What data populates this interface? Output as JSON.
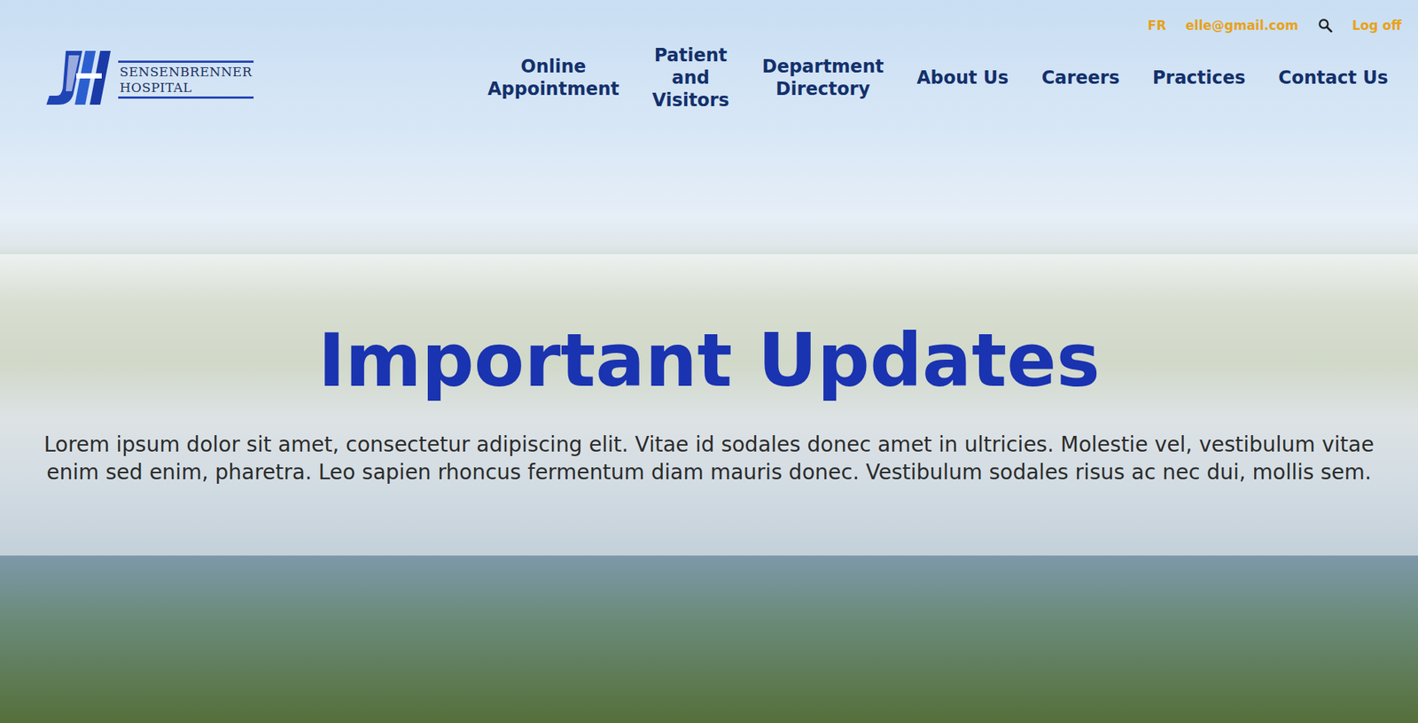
{
  "header": {
    "logo": {
      "line1": "SENSENBRENNER",
      "line2": "HOSPITAL"
    },
    "utility": {
      "language": "FR",
      "account": "elle@gmail.com",
      "logout": "Log off"
    },
    "nav": [
      {
        "label": "Online Appointment"
      },
      {
        "label": "Patient and Visitors"
      },
      {
        "label": "Department Directory"
      },
      {
        "label": "About Us"
      },
      {
        "label": "Careers"
      },
      {
        "label": "Practices"
      },
      {
        "label": "Contact Us"
      }
    ]
  },
  "hero": {
    "title": "Important Updates",
    "text": "Lorem ipsum dolor sit amet, consectetur adipiscing elit. Vitae id sodales donec amet in ultricies. Molestie vel, vestibulum vitae enim sed enim, pharetra. Leo sapien rhoncus fermentum diam mauris donec. Vestibulum sodales risus ac nec dui, mollis sem."
  }
}
